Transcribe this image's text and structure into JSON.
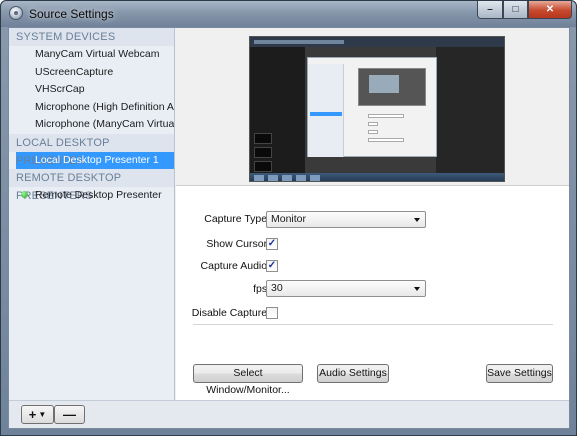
{
  "window": {
    "title": "Source Settings",
    "min_glyph": "–",
    "max_glyph": "□",
    "close_glyph": "✕"
  },
  "sidebar": {
    "sections": [
      {
        "header": "SYSTEM DEVICES",
        "items": [
          "ManyCam Virtual Webcam",
          "UScreenCapture",
          "VHScrCap",
          "Microphone (High Definition Aud",
          "Microphone (ManyCam Virtual Mic"
        ]
      },
      {
        "header": "LOCAL DESKTOP PRESENTER",
        "items": [
          "Local Desktop Presenter 1"
        ]
      },
      {
        "header": "REMOTE DESKTOP PRESENTERS",
        "items": [
          "Remote Desktop Presenter"
        ]
      }
    ],
    "selected_item": "Local Desktop Presenter 1",
    "remote_status_color": "#22aa22"
  },
  "bottom_bar": {
    "add_label": "+",
    "add_arrow": "▼",
    "remove_label": "—"
  },
  "settings": {
    "capture_type_label": "Capture Type:",
    "capture_type_value": "Monitor",
    "show_cursor_label": "Show Cursor:",
    "show_cursor_checked": true,
    "capture_audio_label": "Capture Audio:",
    "capture_audio_checked": true,
    "fps_label": "fps:",
    "fps_value": "30",
    "disable_capture_label": "Disable Capture:",
    "disable_capture_checked": false,
    "check_glyph": "✓"
  },
  "buttons": {
    "select_window": "Select Window/Monitor...",
    "audio_settings": "Audio Settings",
    "save_settings": "Save Settings"
  },
  "colors": {
    "selection": "#3399ff",
    "section_header_text": "#6a7f98"
  }
}
